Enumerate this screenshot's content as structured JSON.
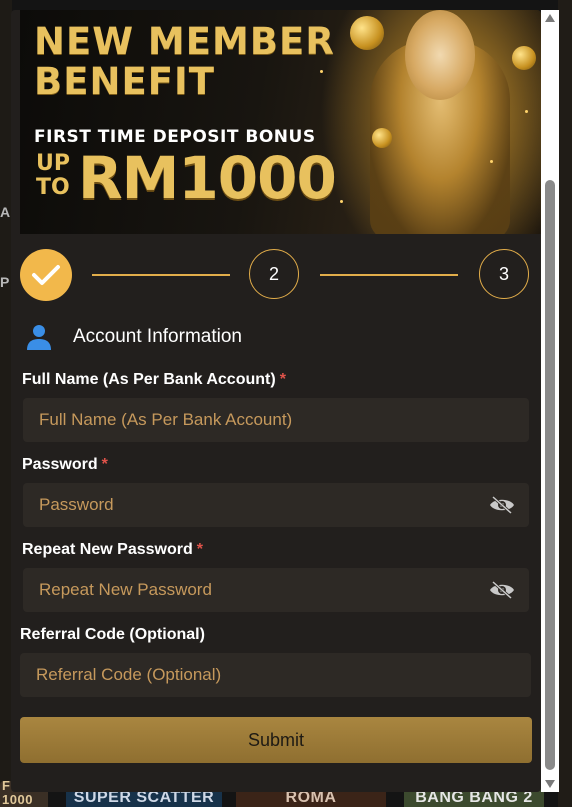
{
  "banner": {
    "title": "NEW MEMBER\nBENEFIT",
    "subtitle": "FIRST TIME DEPOSIT BONUS",
    "up_to": "UP\nTO",
    "amount": "RM1000"
  },
  "stepper": {
    "current_step": 1,
    "steps": [
      {
        "label": "",
        "state": "done"
      },
      {
        "label": "2",
        "state": "pending"
      },
      {
        "label": "3",
        "state": "pending"
      }
    ]
  },
  "section": {
    "title": "Account Information",
    "icon": "person-icon"
  },
  "form": {
    "full_name": {
      "label": "Full Name (As Per Bank Account)",
      "required_mark": "*",
      "placeholder": "Full Name (As Per Bank Account)",
      "value": ""
    },
    "password": {
      "label": "Password",
      "required_mark": "*",
      "placeholder": "Password",
      "value": "",
      "icon": "eye-off-icon"
    },
    "repeat_password": {
      "label": "Repeat New Password",
      "required_mark": "*",
      "placeholder": "Repeat New Password",
      "value": "",
      "icon": "eye-off-icon"
    },
    "referral": {
      "label": "Referral Code (Optional)",
      "placeholder": "Referral Code (Optional)",
      "value": ""
    }
  },
  "submit_label": "Submit",
  "background": {
    "tile_1": "F\n1000",
    "tile_2": "SUPER SCATTER",
    "tile_3": "ROMA",
    "tile_4": "BANG BANG 2",
    "letter_a": "A",
    "letter_p": "P"
  },
  "colors": {
    "accent": "#e2ad4a",
    "step_done": "#f2b84b",
    "modal_bg": "#221f1d",
    "field_bg": "#2d2925",
    "placeholder": "#c6995c",
    "required": "#e0534a",
    "submit_bg": "#a98640"
  }
}
